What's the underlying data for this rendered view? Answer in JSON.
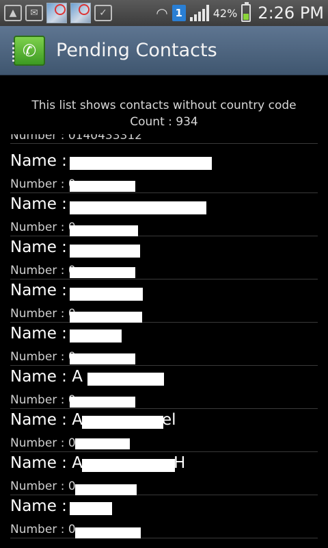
{
  "status_bar": {
    "battery_percent": "42%",
    "battery_level": 0.42,
    "notification_count": "1",
    "time": "2:26 PM",
    "icons": [
      "gallery-icon",
      "mail-icon",
      "image-thumbnail-icon",
      "image-thumbnail-icon",
      "task-icon",
      "wifi-icon",
      "signal-icon",
      "battery-icon"
    ]
  },
  "header": {
    "title": "Pending Contacts"
  },
  "info": {
    "line1": "This list shows contacts without country code",
    "line2": "Count : 934"
  },
  "contacts": {
    "partial_top_number": "Number : 0140433312",
    "items": [
      {
        "name_label": "Name : ",
        "name_suffix": "",
        "number_label": "Number : 0"
      },
      {
        "name_label": "Name : ",
        "name_suffix": "",
        "number_label": "Number : 0"
      },
      {
        "name_label": "Name : ",
        "name_suffix": "",
        "number_label": "Number : 0"
      },
      {
        "name_label": "Name : ",
        "name_suffix": "",
        "number_label": "Number : 0"
      },
      {
        "name_label": "Name : ",
        "name_suffix": "",
        "number_label": "Number : 0"
      },
      {
        "name_label": "Name : A",
        "name_suffix": "",
        "number_label": "Number : 0"
      },
      {
        "name_label": "Name : A",
        "name_suffix": "el",
        "number_label": "Number : 0"
      },
      {
        "name_label": "Name : A",
        "name_suffix": "H",
        "number_label": "Number : 0"
      },
      {
        "name_label": "Name : ",
        "name_suffix": "",
        "number_label": "Number : 0"
      }
    ]
  },
  "colors": {
    "title_bar": "#4e6580",
    "background": "#000000",
    "battery_fill": "#8bd63a",
    "notification_badge": "#2a7fd4"
  }
}
